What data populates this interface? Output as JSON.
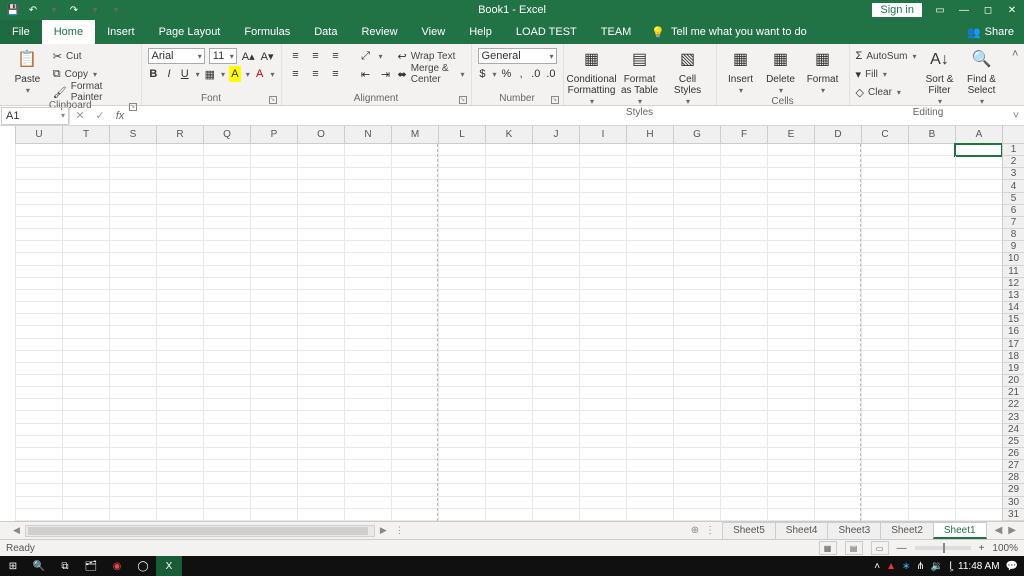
{
  "titlebar": {
    "title": "Book1 - Excel",
    "signin": "Sign in"
  },
  "qa": {
    "undo": "↶",
    "redo": "↷"
  },
  "tabs": [
    "File",
    "Home",
    "Insert",
    "Page Layout",
    "Formulas",
    "Data",
    "Review",
    "View",
    "Help",
    "LOAD TEST",
    "TEAM"
  ],
  "tell_me": "Tell me what you want to do",
  "share": "Share",
  "ribbon": {
    "clipboard": {
      "label": "Clipboard",
      "paste": "Paste",
      "cut": "Cut",
      "copy": "Copy",
      "painter": "Format Painter"
    },
    "font": {
      "label": "Font",
      "name": "Arial",
      "size": "11"
    },
    "alignment": {
      "label": "Alignment",
      "wrap": "Wrap Text",
      "merge": "Merge & Center"
    },
    "number": {
      "label": "Number",
      "format": "General"
    },
    "styles": {
      "label": "Styles",
      "cond": "Conditional Formatting",
      "table": "Format as Table",
      "cell": "Cell Styles"
    },
    "cells": {
      "label": "Cells",
      "insert": "Insert",
      "delete": "Delete",
      "format": "Format"
    },
    "editing": {
      "label": "Editing",
      "autosum": "AutoSum",
      "fill": "Fill",
      "clear": "Clear",
      "sort": "Sort & Filter",
      "find": "Find & Select"
    }
  },
  "namebox": "A1",
  "columns": [
    "A",
    "B",
    "C",
    "D",
    "E",
    "F",
    "G",
    "H",
    "I",
    "J",
    "K",
    "L",
    "M",
    "N",
    "O",
    "P",
    "Q",
    "R",
    "S",
    "T",
    "U"
  ],
  "rows_count": 31,
  "sheets": [
    "Sheet5",
    "Sheet4",
    "Sheet3",
    "Sheet2",
    "Sheet1"
  ],
  "active_sheet": "Sheet1",
  "status": {
    "ready": "Ready",
    "zoom": "100%"
  },
  "taskbar": {
    "time": "11:48 AM"
  }
}
